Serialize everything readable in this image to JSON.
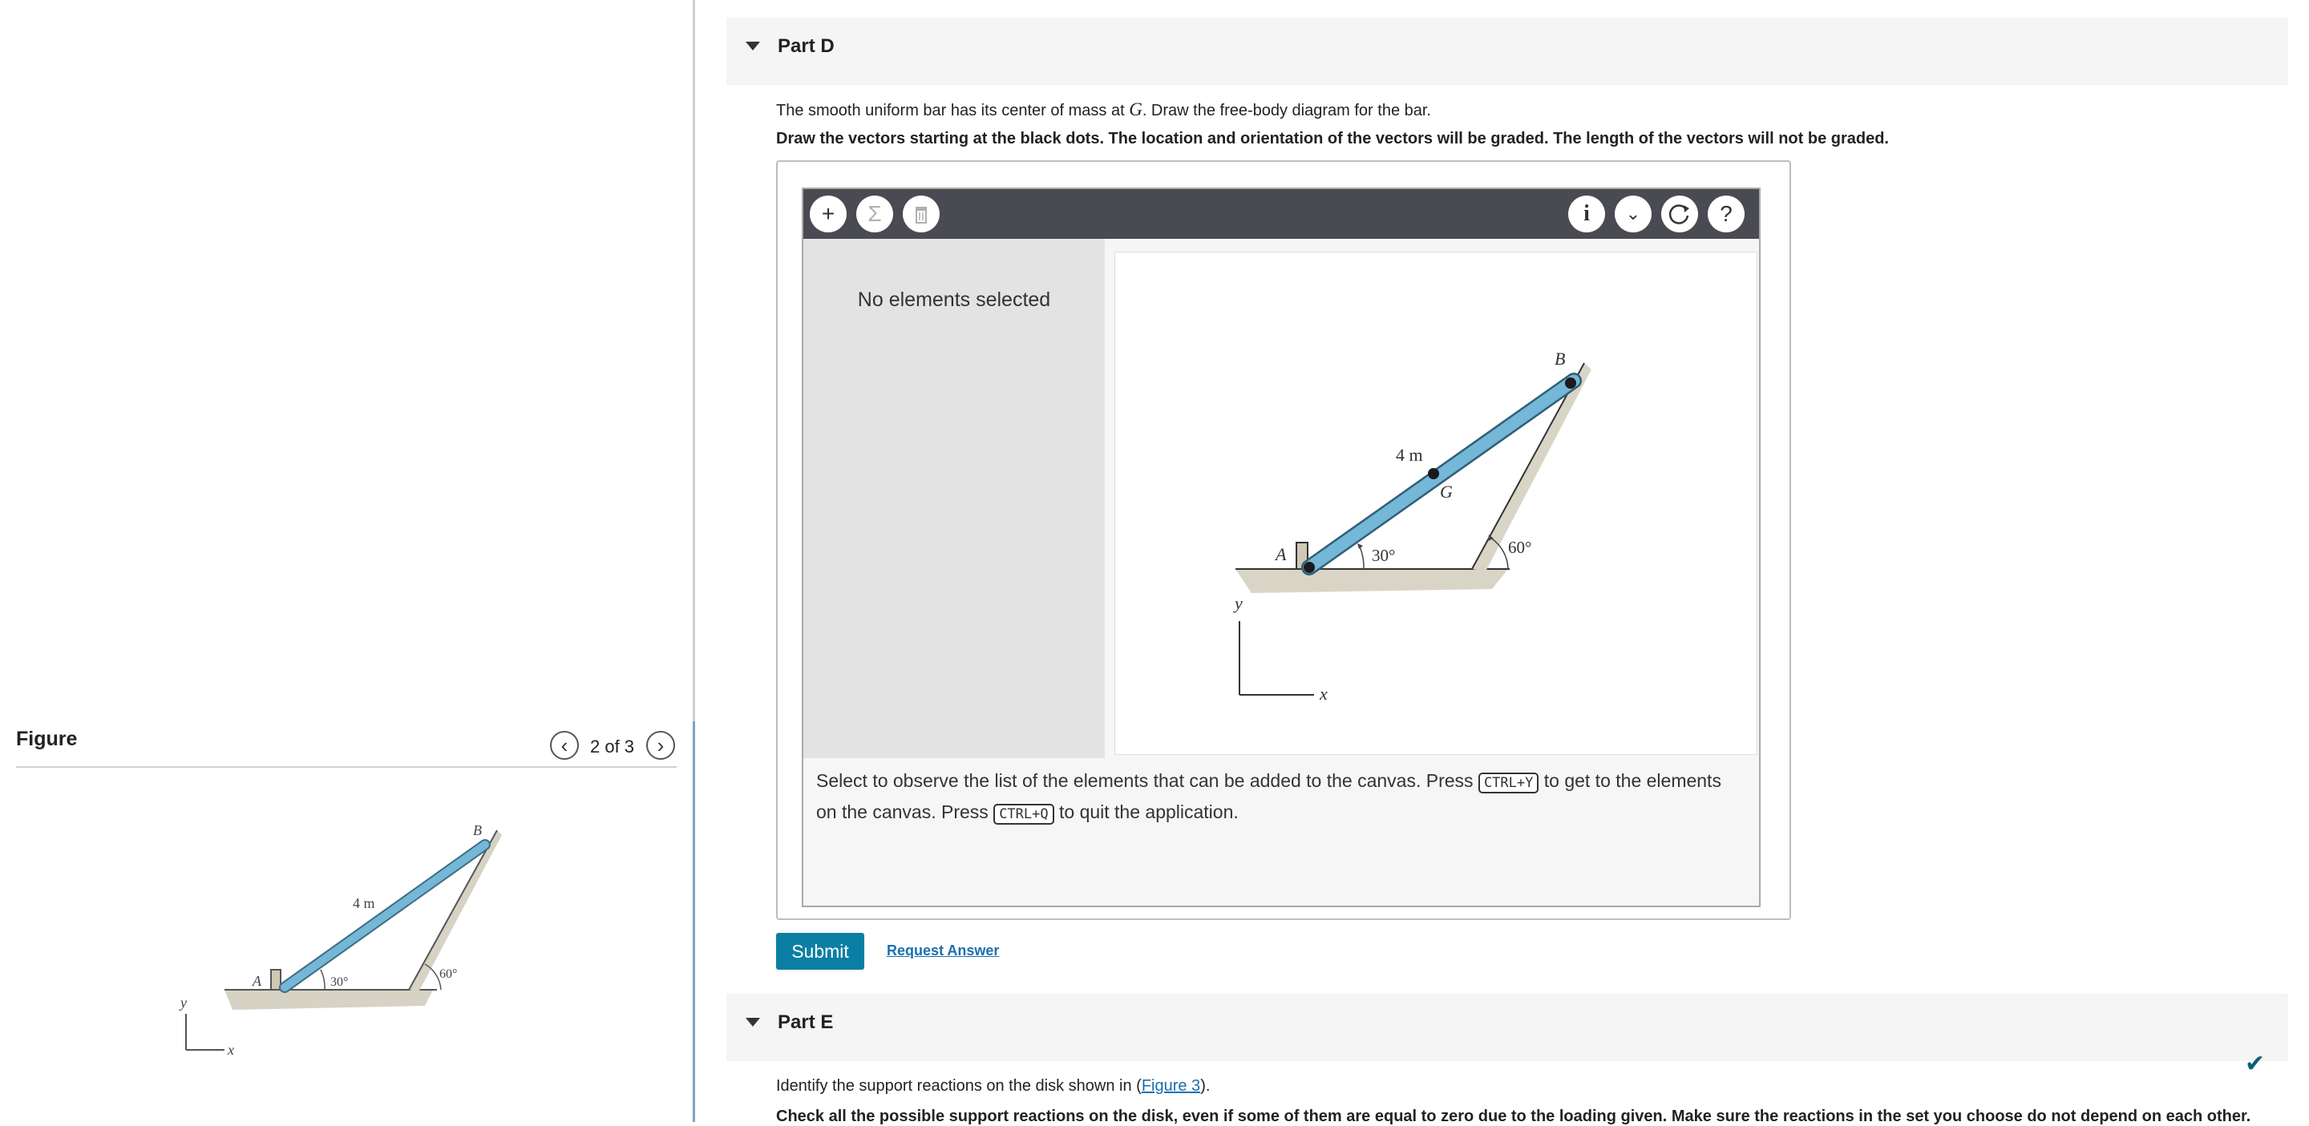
{
  "figure_panel": {
    "title": "Figure",
    "prev_icon": "chevron-left-icon",
    "next_icon": "chevron-right-icon",
    "counter": "2 of 3",
    "diagram": {
      "label_b": "B",
      "label_a": "A",
      "length": "4 m",
      "angle1": "30°",
      "angle2": "60°",
      "axis_y": "y",
      "axis_x": "x"
    }
  },
  "part_d": {
    "title": "Part D",
    "statement_pre": "The smooth uniform bar has its center of mass at ",
    "statement_var": "G",
    "statement_post": ". Draw the free-body diagram for the bar.",
    "instruction": "Draw the vectors starting at the black dots. The location and orientation of the vectors will be graded. The length of the vectors will not be graded.",
    "toolbar": {
      "add_icon": "plus-icon",
      "sigma_icon": "sigma-icon",
      "delete_icon": "trash-icon",
      "info_icon": "info-icon",
      "menu_icon": "chevron-down-icon",
      "reset_icon": "reset-icon",
      "help_icon": "help-icon"
    },
    "side_panel_message": "No elements selected",
    "canvas_diagram": {
      "label_b": "B",
      "label_g": "G",
      "label_a": "A",
      "length": "4 m",
      "angle1": "30°",
      "angle2": "60°",
      "axis_y": "y",
      "axis_x": "x"
    },
    "helper": {
      "part1": "Select to observe the list of the elements that can be added to the canvas. Press ",
      "key1": "CTRL+Y",
      "part2": " to get to the elements on the canvas. Press ",
      "key2": "CTRL+Q",
      "part3": " to quit the application."
    },
    "submit_label": "Submit",
    "request_label": "Request Answer"
  },
  "part_e": {
    "title": "Part E",
    "statement_pre": "Identify the support reactions on the disk shown in (",
    "figure_link": "Figure 3",
    "statement_post": ").",
    "instruction": "Check all the possible support reactions on the disk, even if some of them are equal to zero due to the loading given. Make sure the reactions in the set you choose do not depend on each other.",
    "status_icon": "checkmark-icon"
  },
  "colors": {
    "bar": "#74b7d6",
    "accent": "#0b7fa3",
    "toolbar": "#4a4a52",
    "link": "#1a6fb0"
  }
}
